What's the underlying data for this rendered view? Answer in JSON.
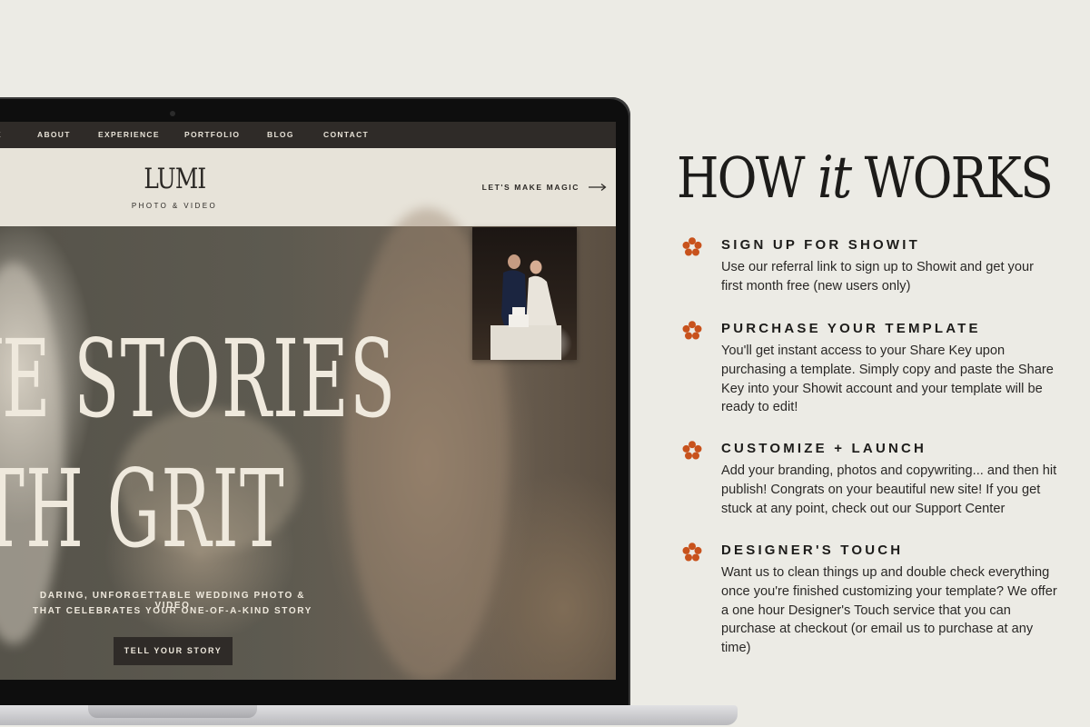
{
  "site": {
    "nav": [
      "E",
      "ABOUT",
      "EXPERIENCE",
      "PORTFOLIO",
      "BLOG",
      "CONTACT"
    ],
    "logo": "LUMI",
    "logo_sub": "PHOTO & VIDEO",
    "cta": "LET'S MAKE MAGIC",
    "hero_line1": "VE STORIES",
    "hero_line2": "ITH GRIT",
    "hero_sub1": "DARING, UNFORGETTABLE WEDDING PHOTO & VIDEO",
    "hero_sub2": "THAT CELEBRATES YOUR ONE-OF-A-KIND STORY",
    "hero_button": "TELL YOUR STORY"
  },
  "how": {
    "title_pre": "HOW ",
    "title_em": "it",
    "title_post": " WORKS",
    "accent_color": "#c8521c",
    "steps": [
      {
        "title": "SIGN UP FOR SHOWIT",
        "body": "Use our referral link to sign up to Showit and get your first month free (new users only)"
      },
      {
        "title": "PURCHASE YOUR TEMPLATE",
        "body": "You'll get instant access to your Share Key upon purchasing a template. Simply copy and paste the Share Key into your Showit account and your template will be ready to edit!"
      },
      {
        "title": "CUSTOMIZE + LAUNCH",
        "body": "Add your branding, photos and copywriting... and then hit publish! Congrats on your beautiful new site! If you get stuck at any point, check out our Support Center"
      },
      {
        "title": "DESIGNER'S TOUCH",
        "body": "Want us to clean things up and double check everything once you're finished customizing your template? We offer a one hour Designer's Touch service that you can purchase at checkout (or email us to purchase at any time)"
      }
    ]
  }
}
